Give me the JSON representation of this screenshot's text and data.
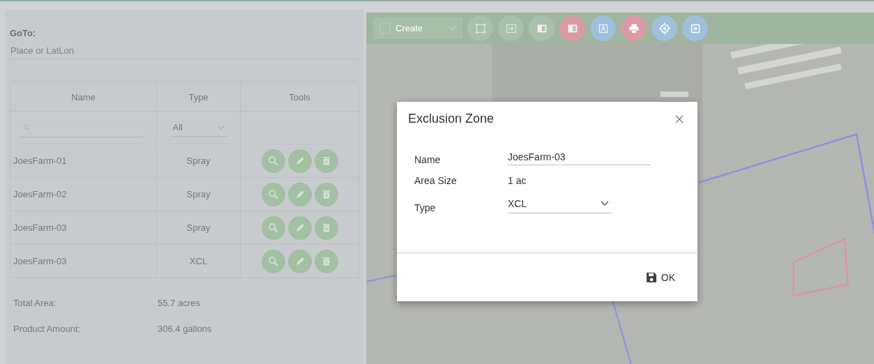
{
  "goto": {
    "label": "GoTo:",
    "placeholder": "Place or LatLon"
  },
  "table": {
    "columns": [
      "Name",
      "Type",
      "Tools"
    ],
    "type_filter": "All",
    "rows": [
      {
        "name": "JoesFarm-01",
        "type": "Spray"
      },
      {
        "name": "JoesFarm-02",
        "type": "Spray"
      },
      {
        "name": "JoesFarm-03",
        "type": "Spray"
      },
      {
        "name": "JoesFarm-03",
        "type": "XCL"
      }
    ]
  },
  "totals": [
    {
      "label": "Total Area:",
      "value": "55.7 acres"
    },
    {
      "label": "Product Amount:",
      "value": "306.4 gallons"
    }
  ],
  "toolbar": {
    "create_label": "Create",
    "buttons": [
      {
        "kind": "select",
        "color": "#a9c0aa"
      },
      {
        "kind": "import",
        "color": "#a9c0aa"
      },
      {
        "kind": "split",
        "color": "#a9c0aa"
      },
      {
        "kind": "split",
        "color": "#d99aa3"
      },
      {
        "kind": "polygon",
        "color": "#9fc0da"
      },
      {
        "kind": "print",
        "color": "#d99aa3"
      },
      {
        "kind": "target",
        "color": "#9fc0da"
      },
      {
        "kind": "settings",
        "color": "#9fc0da"
      }
    ]
  },
  "dialog": {
    "title": "Exclusion Zone",
    "fields": [
      {
        "kind": "input",
        "label": "Name",
        "value": "JoesFarm-03"
      },
      {
        "kind": "text",
        "label": "Area Size",
        "value": "1 ac"
      },
      {
        "kind": "select",
        "label": "Type",
        "value": "XCL"
      }
    ],
    "ok_label": "OK"
  }
}
